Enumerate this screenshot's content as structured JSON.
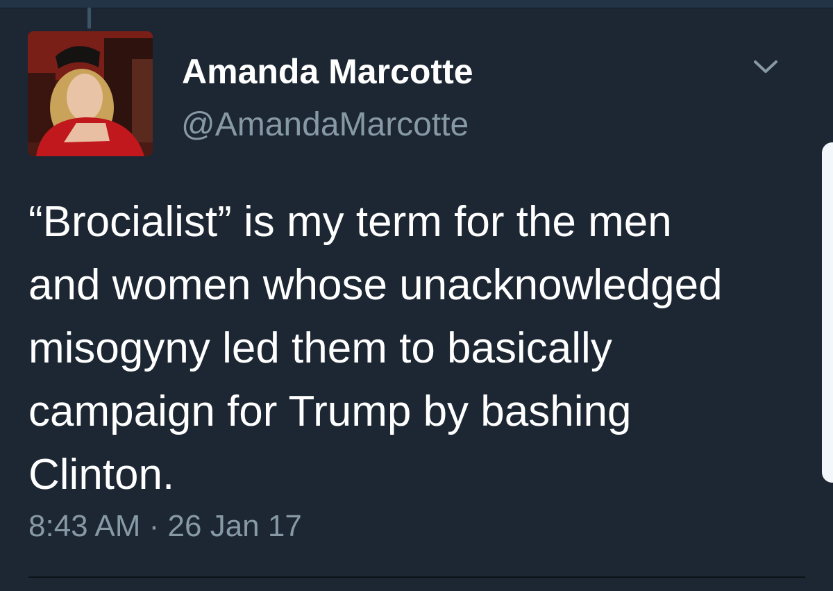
{
  "tweet": {
    "display_name": "Amanda Marcotte",
    "handle": "@AmandaMarcotte",
    "text_lines": [
      "“Brocialist” is my term for the men",
      "and women whose unacknowledged",
      "misogyny led them to basically",
      "campaign for Trump by bashing",
      "Clinton."
    ],
    "timestamp": "8:43 AM · 26 Jan 17",
    "menu_icon": "chevron-down-icon",
    "avatar_icon": "profile-photo"
  },
  "colors": {
    "background": "#1c2733",
    "name": "#ffffff",
    "secondary": "#8899a6",
    "avatar_dress": "#c0181c"
  }
}
